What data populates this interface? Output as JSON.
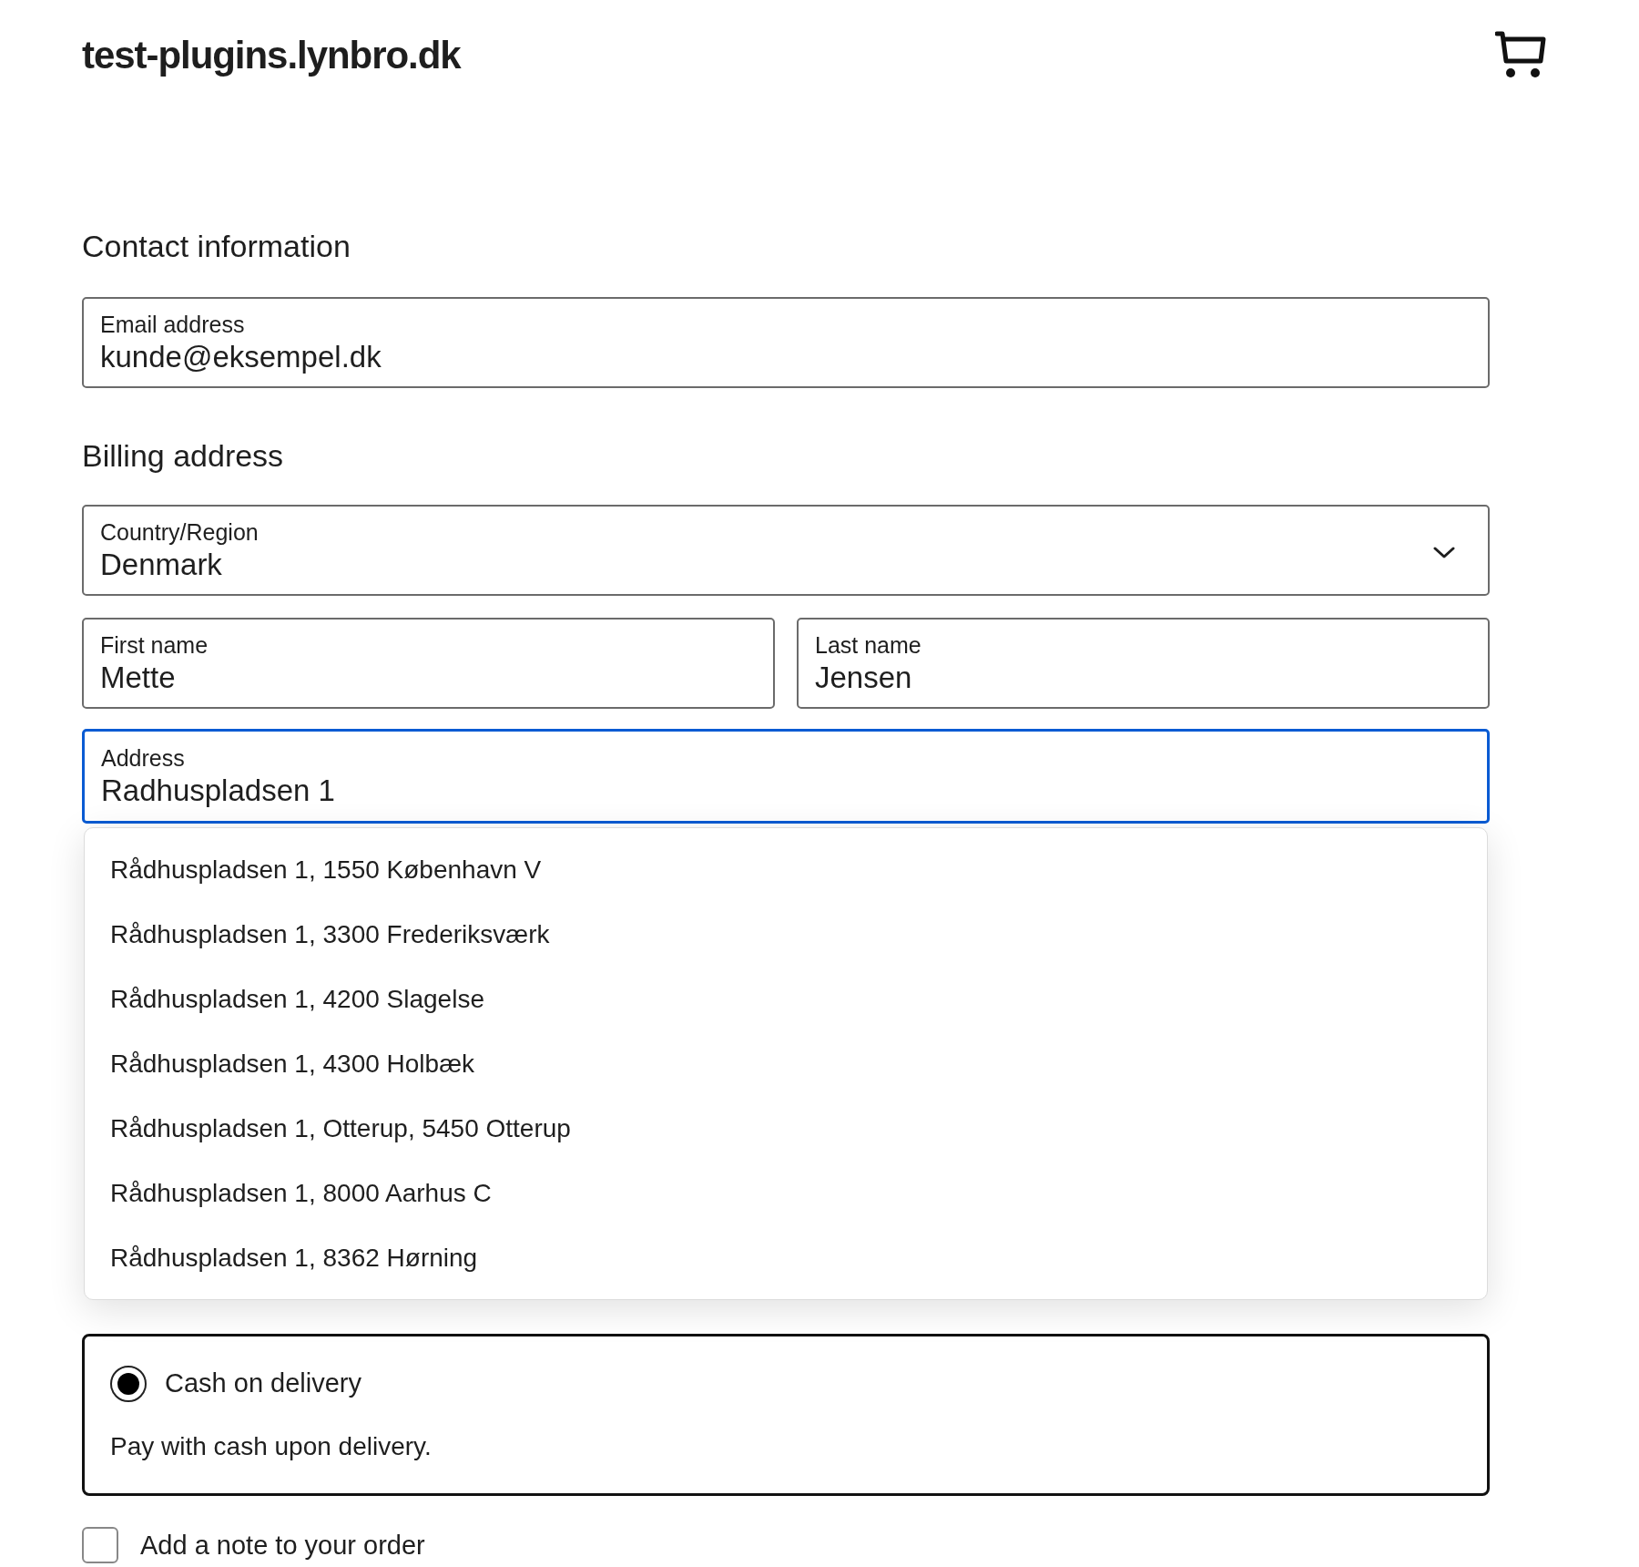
{
  "header": {
    "site_title": "test-plugins.lynbro.dk"
  },
  "contact": {
    "heading": "Contact information",
    "email": {
      "label": "Email address",
      "value": "kunde@eksempel.dk"
    }
  },
  "billing": {
    "heading": "Billing address",
    "country": {
      "label": "Country/Region",
      "value": "Denmark"
    },
    "first_name": {
      "label": "First name",
      "value": "Mette"
    },
    "last_name": {
      "label": "Last name",
      "value": "Jensen"
    },
    "address": {
      "label": "Address",
      "value": "Radhuspladsen 1",
      "focused": true
    },
    "suggestions": [
      {
        "text": "Rådhuspladsen 1, 1550 København V"
      },
      {
        "text": "Rådhuspladsen 1, 3300 Frederiksværk"
      },
      {
        "text": "Rådhuspladsen 1, 4200 Slagelse"
      },
      {
        "text": "Rådhuspladsen 1, 4300 Holbæk"
      },
      {
        "text": "Rådhuspladsen 1, Otterup, 5450 Otterup"
      },
      {
        "text": "Rådhuspladsen 1, 8000 Aarhus C"
      },
      {
        "text": "Rådhuspladsen 1, 8362 Hørning"
      }
    ]
  },
  "payment": {
    "options": [
      {
        "label": "Cash on delivery",
        "description": "Pay with cash upon delivery.",
        "selected": true
      }
    ]
  },
  "order_note": {
    "label": "Add a note to your order",
    "checked": false
  }
}
